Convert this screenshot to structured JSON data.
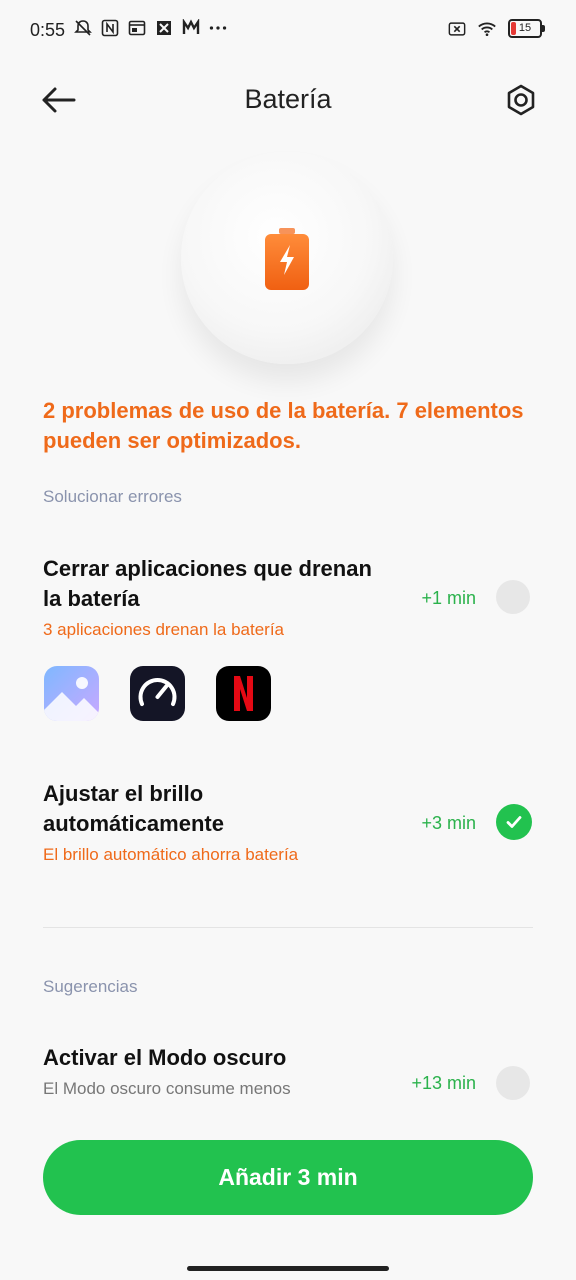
{
  "status_bar": {
    "time": "0:55",
    "icons_left": [
      "silent-icon",
      "nfc-icon",
      "screen-cast-icon",
      "app-notification-icon",
      "app-notification-icon",
      "more-icon"
    ],
    "icons_right": [
      "no-sim-icon",
      "wifi-icon",
      "battery-icon"
    ],
    "battery_level": "15"
  },
  "header": {
    "title": "Batería"
  },
  "hero": {
    "headline": "2 problemas de uso de la batería.  7 elementos pueden ser optimizados."
  },
  "fix_section": {
    "label": "Solucionar errores",
    "items": [
      {
        "title": "Cerrar aplicaciones que drenan la batería",
        "subtitle": "3 aplicaciones drenan la batería",
        "gain": "+1 min",
        "checked": false,
        "apps": [
          "gallery-app-icon",
          "speedtest-app-icon",
          "netflix-app-icon"
        ]
      },
      {
        "title": "Ajustar el brillo automáticamente",
        "subtitle": "El brillo automático ahorra batería",
        "gain": "+3 min",
        "checked": true
      }
    ]
  },
  "suggestions_section": {
    "label": "Sugerencias",
    "items": [
      {
        "title": "Activar el Modo oscuro",
        "subtitle": "El Modo oscuro consume menos",
        "gain": "+13 min",
        "checked": false
      }
    ]
  },
  "action_button": {
    "label": "Añadir 3 min"
  },
  "colors": {
    "accent_orange": "#ef6a1a",
    "accent_green": "#22c24f",
    "section_label": "#8a93ad"
  }
}
